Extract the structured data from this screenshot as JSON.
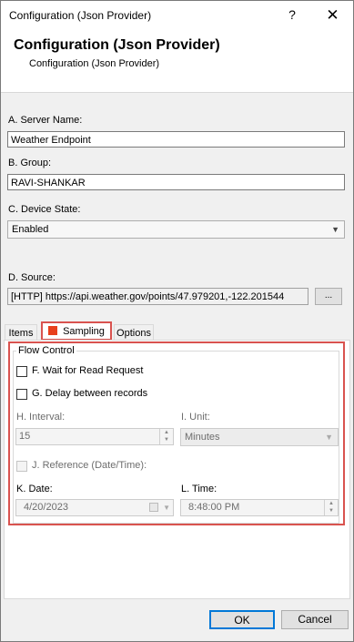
{
  "window": {
    "title": "Configuration (Json Provider)",
    "help_glyph": "?",
    "close_glyph": "✕"
  },
  "header": {
    "title": "Configuration (Json Provider)",
    "subtitle": "Configuration (Json Provider)"
  },
  "fields": {
    "server_name": {
      "label": "A. Server Name:",
      "value": "Weather Endpoint"
    },
    "group": {
      "label": "B. Group:",
      "value": "RAVI-SHANKAR"
    },
    "device_state": {
      "label": "C. Device State:",
      "value": "Enabled"
    },
    "source": {
      "label": "D. Source:",
      "value": "[HTTP] https://api.weather.gov/points/47.979201,-122.201544",
      "browse_label": "..."
    }
  },
  "tabs": [
    {
      "label": "Items"
    },
    {
      "label": "Sampling",
      "active": true
    },
    {
      "label": "Options"
    }
  ],
  "sampling": {
    "group_title": "Flow Control",
    "wait_for_read": {
      "label": "F. Wait for Read Request",
      "checked": false
    },
    "delay_between": {
      "label": "G. Delay between records",
      "checked": false
    },
    "interval": {
      "label": "H. Interval:",
      "value": "15"
    },
    "unit": {
      "label": "I. Unit:",
      "value": "Minutes"
    },
    "reference": {
      "label": "J. Reference (Date/Time):",
      "checked": false
    },
    "date": {
      "label": "K. Date:",
      "value": "4/20/2023"
    },
    "time": {
      "label": "L. Time:",
      "value": "8:48:00 PM"
    }
  },
  "footer": {
    "ok_label": "OK",
    "cancel_label": "Cancel"
  },
  "colors": {
    "highlight": "#d9534f",
    "tab_icon": "#e8401c",
    "ok_border": "#0078d7"
  }
}
